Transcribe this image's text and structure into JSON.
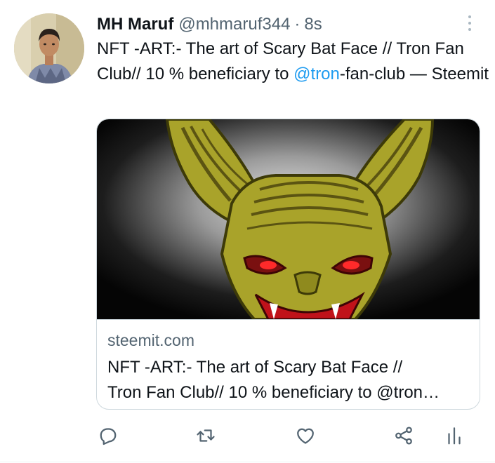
{
  "tweet": {
    "author": {
      "display_name": "MH Maruf",
      "handle": "@mhmaruf344",
      "separator": "·",
      "time": "8s"
    },
    "text": {
      "before_mention": "NFT -ART:- The art of Scary Bat Face // Tron Fan Club// 10 % beneficiary to ",
      "mention": "@tron",
      "after_mention": "-fan-club — Steemit"
    },
    "card": {
      "domain": "steemit.com",
      "title_line1": "NFT -ART:- The art of Scary Bat Face //",
      "title_line2": "Tron Fan Club// 10 % beneficiary to @tron…"
    },
    "actions": [
      "reply-icon",
      "retweet-icon",
      "like-icon",
      "share-icon",
      "analytics-icon"
    ]
  },
  "colors": {
    "text": "#0f1419",
    "secondary": "#536471",
    "link": "#1d9bf0",
    "border": "#cfd9de",
    "bat_skin": "#a9a32a",
    "bat_shadow": "#5b5412",
    "bat_eyes": "#e01a1a"
  }
}
